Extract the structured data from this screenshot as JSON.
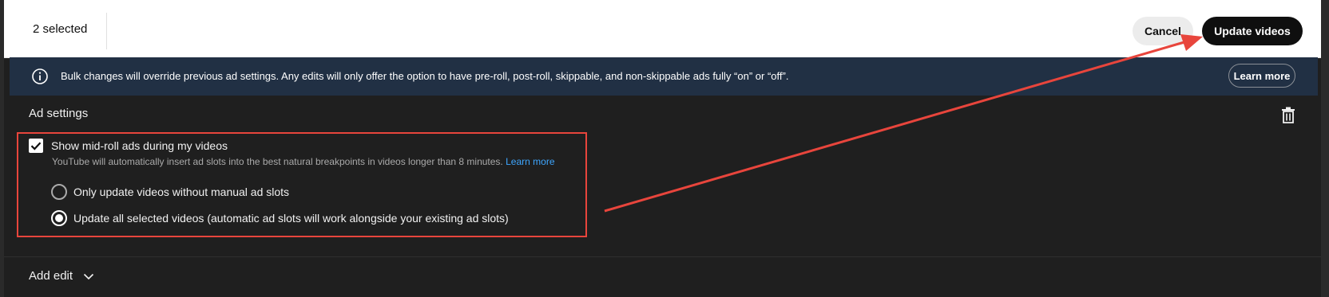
{
  "header": {
    "selected_count": "2 selected",
    "cancel_label": "Cancel",
    "update_label": "Update videos"
  },
  "banner": {
    "icon": "info-icon",
    "text": "Bulk changes will override previous ad settings. Any edits will only offer the option to have pre-roll, post-roll, skippable, and non-skippable ads fully “on” or “off”.",
    "learn_more_label": "Learn more"
  },
  "ad_settings": {
    "title": "Ad settings",
    "delete_icon": "trash-icon",
    "midroll": {
      "checked": true,
      "label": "Show mid-roll ads during my videos",
      "description": "YouTube will automatically insert ad slots into the best natural breakpoints in videos longer than 8 minutes.",
      "learn_more": "Learn more"
    },
    "options": [
      {
        "label": "Only update videos without manual ad slots",
        "selected": false
      },
      {
        "label": "Update all selected videos (automatic ad slots will work alongside your existing ad slots)",
        "selected": true
      }
    ]
  },
  "footer": {
    "add_edit_label": "Add edit",
    "chevron_icon": "chevron-down-icon"
  },
  "colors": {
    "annotation": "#e8453c",
    "banner_bg": "#213044",
    "link": "#3ea6ff"
  }
}
